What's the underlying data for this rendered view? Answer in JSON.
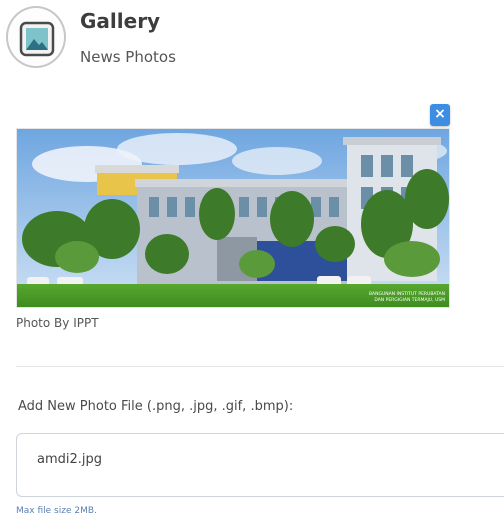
{
  "header": {
    "title": "Gallery",
    "subtitle": "News Photos",
    "icon": "image-icon"
  },
  "photo": {
    "remove_label": "×",
    "caption": "Photo By IPPT",
    "watermark_line1": "BANGUNAN INSTITUT PERUBATAN",
    "watermark_line2": "DAN PERGIGIAN TERMAJU, USM"
  },
  "upload": {
    "label": "Add New Photo File (.png, .jpg, .gif, .bmp):",
    "file_value": "amdi2.jpg",
    "help": "Max file size 2MB."
  },
  "colors": {
    "accent": "#3c8ee2",
    "help_text": "#5b7fb3"
  }
}
